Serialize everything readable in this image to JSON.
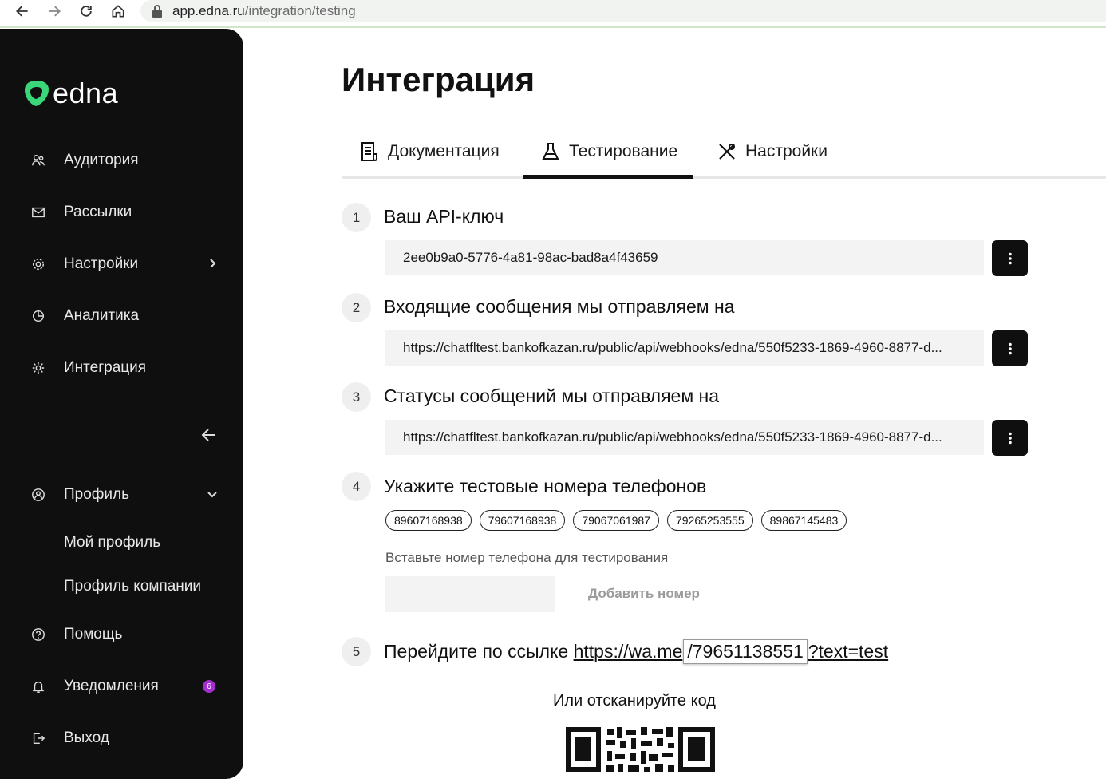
{
  "browser": {
    "url_host": "app.edna.ru",
    "url_path": "/integration/testing"
  },
  "sidebar": {
    "logo_text": "edna",
    "items": [
      {
        "label": "Аудитория"
      },
      {
        "label": "Рассылки"
      },
      {
        "label": "Настройки"
      },
      {
        "label": "Аналитика"
      },
      {
        "label": "Интеграция"
      },
      {
        "label": "Профиль"
      },
      {
        "label": "Помощь"
      },
      {
        "label": "Уведомления",
        "badge": "6"
      },
      {
        "label": "Выход"
      }
    ],
    "sub_items": [
      "Мой профиль",
      "Профиль компании"
    ]
  },
  "page": {
    "title": "Интеграция",
    "tabs": [
      {
        "label": "Документация"
      },
      {
        "label": "Тестирование",
        "active": true
      },
      {
        "label": "Настройки"
      }
    ]
  },
  "steps": [
    {
      "num": "1",
      "title": "Ваш API-ключ",
      "value": "2ee0b9a0-5776-4a81-98ac-bad8a4f43659"
    },
    {
      "num": "2",
      "title": "Входящие сообщения мы отправляем на",
      "value": "https://chatfltest.bankofkazan.ru/public/api/webhooks/edna/550f5233-1869-4960-8877-d..."
    },
    {
      "num": "3",
      "title": "Статусы сообщений мы отправляем на",
      "value": "https://chatfltest.bankofkazan.ru/public/api/webhooks/edna/550f5233-1869-4960-8877-d..."
    },
    {
      "num": "4",
      "title": "Укажите тестовые номера телефонов"
    },
    {
      "num": "5",
      "title": "Перейдите по ссылке"
    }
  ],
  "phones": [
    "89607168938",
    "79607168938",
    "79067061987",
    "79265253555",
    "89867145483"
  ],
  "phone_input": {
    "hint": "Вставьте номер телефона для тестирования",
    "value": "",
    "add_label": "Добавить номер"
  },
  "link": {
    "prefix": "https://wa.me",
    "phone": "/79651138551",
    "suffix": "?text=test"
  },
  "scan_text": "Или отсканируйте код",
  "colors": {
    "sidebar_bg": "#0f0f0f",
    "accent_green": "#3ad67a",
    "badge": "#a42fd1"
  }
}
